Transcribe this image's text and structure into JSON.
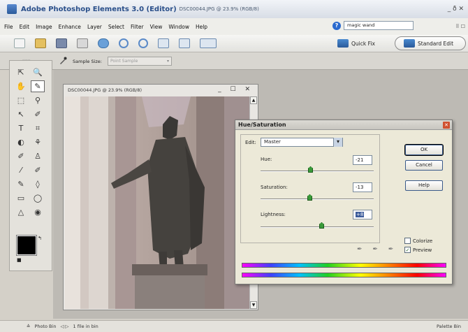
{
  "window": {
    "title_main": "Adobe Photoshop Elements 3.0 (Editor)",
    "title_doc": "DSC00044.JPG @ 23.9% (RGB/8)",
    "controls": "_ ð ✕"
  },
  "menus": [
    "File",
    "Edit",
    "Image",
    "Enhance",
    "Layer",
    "Select",
    "Filter",
    "View",
    "Window",
    "Help"
  ],
  "help_search": {
    "value": "magic wand"
  },
  "menu_right_glyph": "⠿ ☐",
  "modes": {
    "quick_fix": "Quick Fix",
    "standard_edit": "Standard Edit"
  },
  "options": {
    "sample_size_label": "Sample Size:",
    "sample_size_value": "Point Sample",
    "grip": "......"
  },
  "toolbox": {
    "tools": [
      "⇱",
      "🔍",
      "✋",
      "✎",
      "⬚",
      "⚲",
      "↖",
      "✐",
      "T",
      "⌗",
      "◐",
      "⚘",
      "✐",
      "♙",
      "⁄",
      "✐",
      "✎",
      "◊",
      "▭",
      "◯",
      "△",
      "◉"
    ]
  },
  "document": {
    "title": "DSC00044.JPG @ 23.9% (RGB/8)",
    "controls": "_ ☐ ✕"
  },
  "hue_saturation": {
    "title": "Hue/Saturation",
    "edit_label": "Edit:",
    "edit_value": "Master",
    "hue_label": "Hue:",
    "hue_value": "-21",
    "saturation_label": "Saturation:",
    "saturation_value": "-13",
    "lightness_label": "Lightness:",
    "lightness_value": "+8",
    "ok_label": "OK",
    "cancel_label": "Cancel",
    "help_label": "Help",
    "colorize_label": "Colorize",
    "preview_label": "Preview",
    "colorize_checked": false,
    "preview_checked": true,
    "eyedroppers": "✒ ✒ ✒"
  },
  "statusbar": {
    "photo_bin": "Photo Bin",
    "file_count": "1 file in bin",
    "palette_bin": "Palette Bin",
    "arrows": "◁ ▷"
  },
  "colors": {
    "accent": "#2a4f8a",
    "foreground": "#000000",
    "thumb": "#3a9a3a"
  }
}
